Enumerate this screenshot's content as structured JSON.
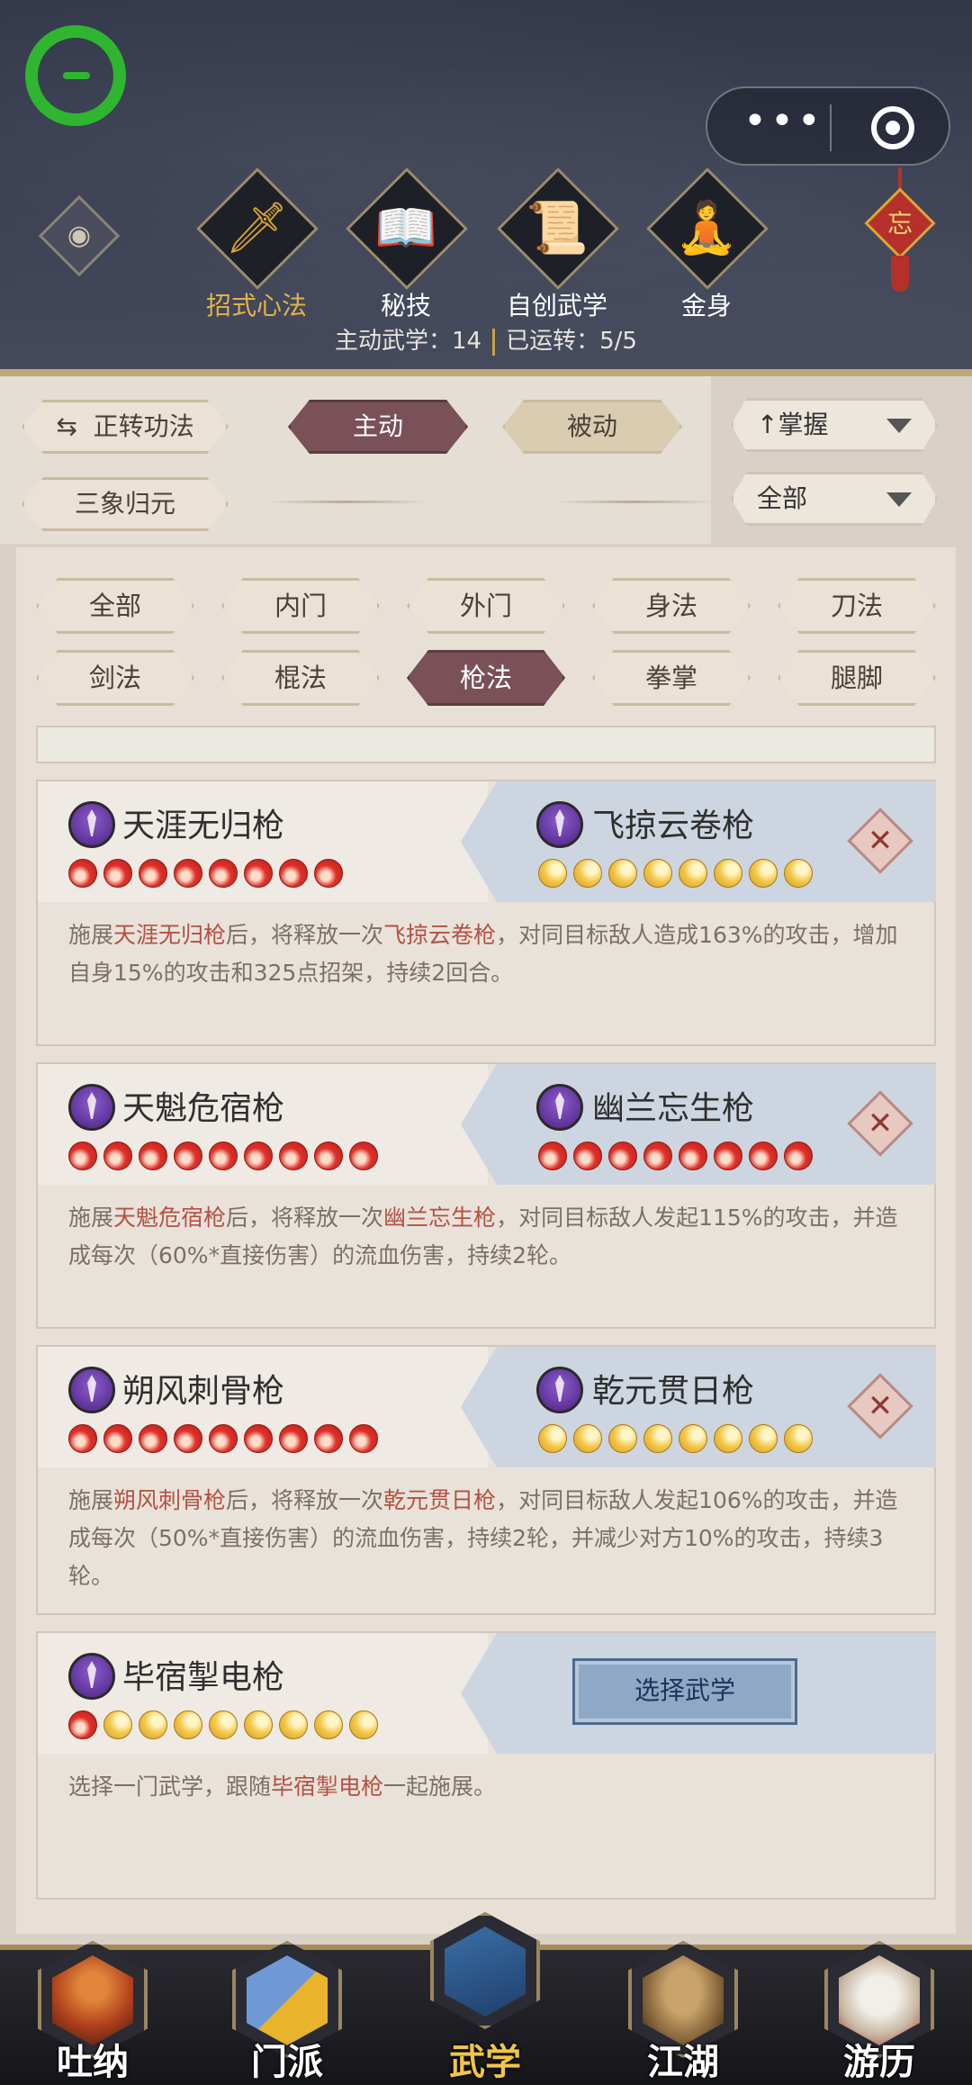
{
  "top_nav": {
    "items": [
      {
        "label": "招式心法",
        "icon": "sword-icon",
        "active": true
      },
      {
        "label": "秘技",
        "icon": "scroll-book-icon"
      },
      {
        "label": "自创武学",
        "icon": "scroll-brush-icon"
      },
      {
        "label": "金身",
        "icon": "meditation-icon"
      }
    ],
    "ornament_char": "忘"
  },
  "capsule": {
    "more": "•••",
    "target_icon": "target-icon"
  },
  "stats": {
    "active_label": "主动武学：14",
    "cycled_label": "已运转：5/5"
  },
  "controls": {
    "cycle_btn": "正转功法",
    "active_tab": "主动",
    "passive_tab": "被动",
    "sanxiang_btn": "三象归元",
    "sort_dropdown": "掌握",
    "filter_dropdown": "全部",
    "sort_arrow": "↑",
    "cycle_icon": "⇆"
  },
  "categories": [
    "全部",
    "内门",
    "外门",
    "身法",
    "刀法",
    "剑法",
    "棍法",
    "枪法",
    "拳掌",
    "腿脚"
  ],
  "selected_category": "枪法",
  "cards": [
    {
      "left_name": "天涯无归枪",
      "left_orbs": [
        "fire",
        "fire",
        "fire",
        "fire",
        "fire",
        "fire",
        "fire",
        "fire"
      ],
      "right_name": "飞掠云卷枪",
      "right_orbs": [
        "moon",
        "moon",
        "moon",
        "moon",
        "moon",
        "moon",
        "moon",
        "moon"
      ],
      "desc_pre": "施展",
      "desc_a": "天涯无归枪",
      "desc_mid": "后，将释放一次",
      "desc_b": "飞掠云卷枪",
      "desc_post": "，对同目标敌人造成163%的攻击，增加自身15%的攻击和325点招架，持续2回合。"
    },
    {
      "left_name": "天魁危宿枪",
      "left_orbs": [
        "fire",
        "fire",
        "fire",
        "fire",
        "fire",
        "fire",
        "fire",
        "fire",
        "fire"
      ],
      "right_name": "幽兰忘生枪",
      "right_orbs": [
        "fire",
        "fire",
        "fire",
        "fire",
        "fire",
        "fire",
        "fire",
        "fire"
      ],
      "desc_pre": "施展",
      "desc_a": "天魁危宿枪",
      "desc_mid": "后，将释放一次",
      "desc_b": "幽兰忘生枪",
      "desc_post": "，对同目标敌人发起115%的攻击，并造成每次（60%*直接伤害）的流血伤害，持续2轮。"
    },
    {
      "left_name": "朔风刺骨枪",
      "left_orbs": [
        "fire",
        "fire",
        "fire",
        "fire",
        "fire",
        "fire",
        "fire",
        "fire",
        "fire"
      ],
      "right_name": "乾元贯日枪",
      "right_orbs": [
        "moon",
        "moon",
        "moon",
        "moon",
        "moon",
        "moon",
        "moon",
        "moon"
      ],
      "desc_pre": "施展",
      "desc_a": "朔风刺骨枪",
      "desc_mid": "后，将释放一次",
      "desc_b": "乾元贯日枪",
      "desc_post": "，对同目标敌人发起106%的攻击，并造成每次（50%*直接伤害）的流血伤害，持续2轮，并减少对方10%的攻击，持续3轮。"
    },
    {
      "left_name": "毕宿掣电枪",
      "left_orbs": [
        "fire",
        "moon",
        "moon",
        "moon",
        "moon",
        "moon",
        "moon",
        "moon",
        "moon"
      ],
      "select_label": "选择武学",
      "desc_pre": "选择一门武学，跟随",
      "desc_a": "毕宿掣电枪",
      "desc_post": "一起施展。"
    }
  ],
  "bottom_nav": {
    "items": [
      {
        "label": "吐纳",
        "icon": "monk-icon"
      },
      {
        "label": "门派",
        "icon": "sect-cards-icon"
      },
      {
        "label": "武学",
        "icon": "martial-books-icon",
        "active": true
      },
      {
        "label": "江湖",
        "icon": "straw-hat-icon"
      },
      {
        "label": "游历",
        "icon": "horse-icon"
      }
    ]
  },
  "colors": {
    "accent_gold": "#e2b347",
    "tab_active": "#7a5158",
    "link_red": "#b45142",
    "select_blue": "#8fa8c6"
  }
}
